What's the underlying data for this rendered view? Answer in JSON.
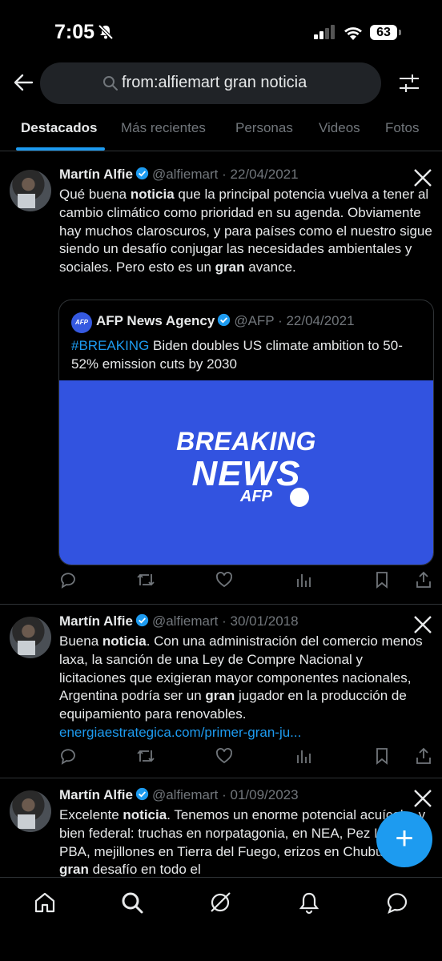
{
  "status": {
    "time": "7:05",
    "battery": "63"
  },
  "search": {
    "query": "from:alfiemart gran noticia"
  },
  "tabs": [
    "Destacados",
    "Más recientes",
    "Personas",
    "Videos",
    "Fotos"
  ],
  "tweets": [
    {
      "name": "Martín Alfie",
      "handle": "@alfiemart",
      "date": "· 22/04/2021",
      "quote": {
        "name": "AFP News Agency",
        "handle": "@AFP",
        "date": "· 22/04/2021",
        "avatar_text": "AFP",
        "hashtag": "#BREAKING",
        "text": " Biden doubles US climate ambition to 50-52% emission cuts by 2030",
        "media": {
          "line1": "BREAKING",
          "line2": "NEWS",
          "line3": "AFP",
          "color": "#3253e0"
        }
      }
    },
    {
      "name": "Martín Alfie",
      "handle": "@alfiemart",
      "date": "· 30/01/2018",
      "link": "energiaestrategica.com/primer-gran-ju..."
    },
    {
      "name": "Martín Alfie",
      "handle": "@alfiemart",
      "date": "· 01/09/2023"
    }
  ],
  "text_t1": [
    "Qué buena ",
    "noticia",
    " que la principal potencia vuelva a tener al cambio climático como prioridad en su agenda. Obviamente hay muchos claroscuros, y para países como el nuestro sigue siendo un desafío conjugar las necesidades ambientales y sociales. Pero esto es un ",
    "gran",
    " avance."
  ],
  "text_t2": [
    "Buena ",
    "noticia",
    ". Con una administración del comercio menos laxa, la sanción de una Ley de Compre Nacional y licitaciones que exigieran mayor componentes nacionales, Argentina podría ser un ",
    "gran",
    " jugador en la producción de equipamiento para renovables."
  ],
  "text_t3": [
    "Excelente ",
    "noticia",
    ". Tenemos un enorme potencial acuícola, y bien federal: truchas en norpatagonia, en NEA, Pez Limón en PBA, mejillones en Tierra del Fuego, erizos en Chubut, y un ",
    "gran",
    " desafío en todo el"
  ],
  "fab": {
    "label": "+"
  },
  "colors": {
    "accent": "#1d9bf0",
    "background": "#000000",
    "muted": "#71767b",
    "divider": "#2f3336"
  },
  "icons": {
    "actions": [
      "reply-icon",
      "retweet-icon",
      "like-icon",
      "views-icon",
      "bookmark-icon",
      "share-icon"
    ],
    "nav": [
      "home-icon",
      "search-icon",
      "grok-icon",
      "notifications-icon",
      "messages-icon"
    ]
  }
}
